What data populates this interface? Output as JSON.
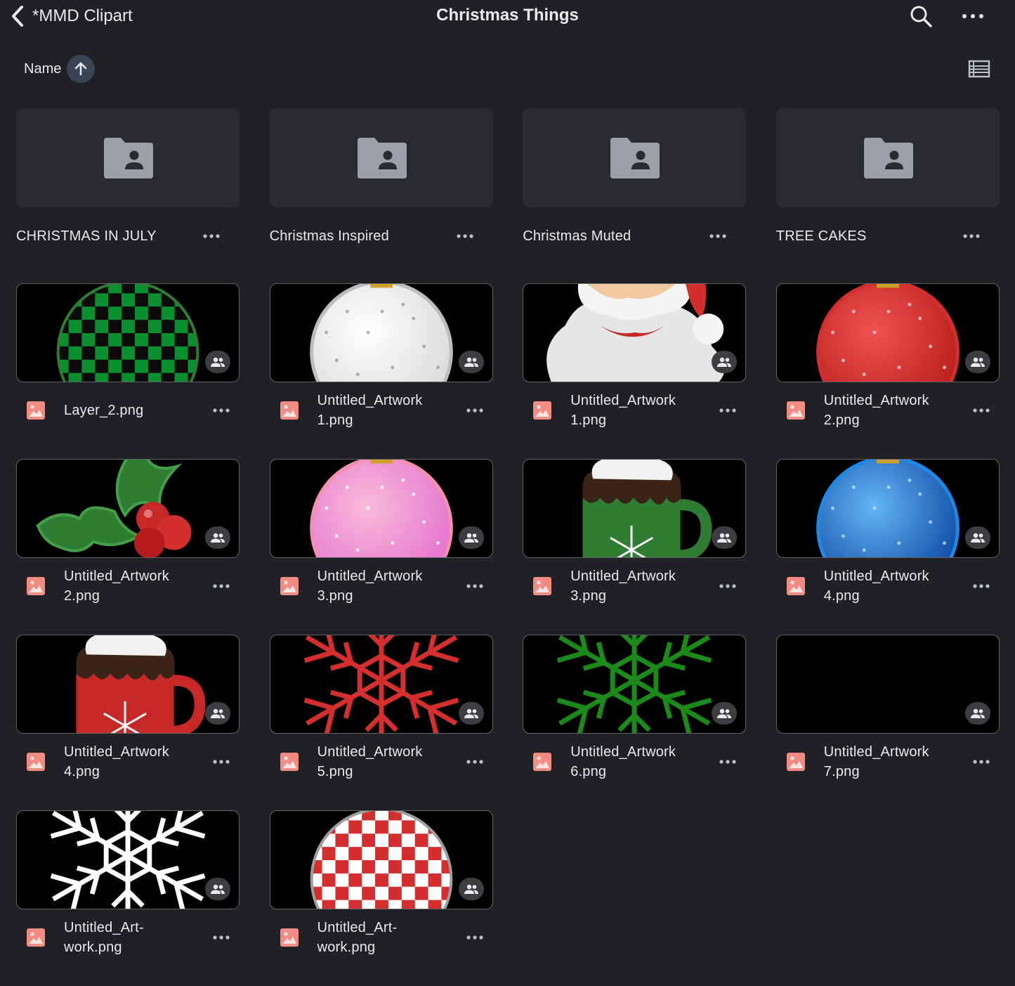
{
  "header": {
    "back_label": "*MMD Clipart",
    "title": "Christmas Things"
  },
  "sort": {
    "label": "Name",
    "direction": "ascending"
  },
  "folders": [
    {
      "name": "CHRISTMAS IN JULY"
    },
    {
      "name": "Christmas Inspired"
    },
    {
      "name": "Christmas Muted"
    },
    {
      "name": "TREE CAKES"
    }
  ],
  "files": [
    {
      "line1": "Layer_2.png",
      "line2": "",
      "art": "green-check-ornament"
    },
    {
      "line1": "Untitled_Artwork",
      "line2": "1.png",
      "art": "white-ornament"
    },
    {
      "line1": "Untitled_Artwork",
      "line2": "1.png",
      "art": "santa"
    },
    {
      "line1": "Untitled_Artwork",
      "line2": "2.png",
      "art": "red-ornament"
    },
    {
      "line1": "Untitled_Artwork",
      "line2": "2.png",
      "art": "holly"
    },
    {
      "line1": "Untitled_Artwork",
      "line2": "3.png",
      "art": "pink-ornament"
    },
    {
      "line1": "Untitled_Artwork",
      "line2": "3.png",
      "art": "green-mug"
    },
    {
      "line1": "Untitled_Artwork",
      "line2": "4.png",
      "art": "blue-ornament"
    },
    {
      "line1": "Untitled_Artwork",
      "line2": "4.png",
      "art": "red-mug"
    },
    {
      "line1": "Untitled_Artwork",
      "line2": "5.png",
      "art": "red-snowflake"
    },
    {
      "line1": "Untitled_Artwork",
      "line2": "6.png",
      "art": "green-snowflake"
    },
    {
      "line1": "Untitled_Artwork",
      "line2": "7.png",
      "art": "blank"
    },
    {
      "line1": "Untitled_Art-",
      "line2": "work.png",
      "art": "white-snowflake"
    },
    {
      "line1": "Untitled_Art-",
      "line2": "work.png",
      "art": "red-check-ornament"
    }
  ],
  "colors": {
    "background": "#202124",
    "folder_bg": "#2a2b2f",
    "image_icon": "#f28b82",
    "sort_button": "#394457"
  }
}
